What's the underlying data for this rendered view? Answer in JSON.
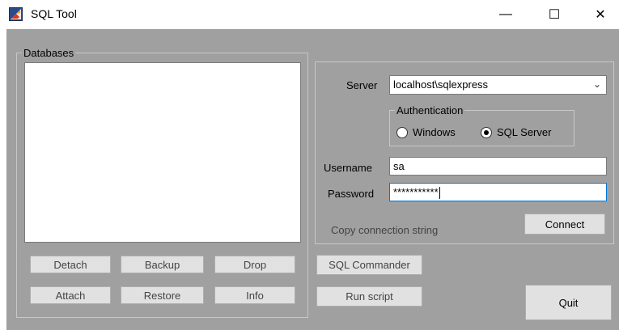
{
  "window": {
    "title": "SQL Tool",
    "controls": {
      "minimize": "—",
      "maximize": "☐",
      "close": "✕"
    }
  },
  "databases": {
    "group_label": "Databases",
    "items": [],
    "buttons": {
      "detach": "Detach",
      "backup": "Backup",
      "drop": "Drop",
      "attach": "Attach",
      "restore": "Restore",
      "info": "Info"
    }
  },
  "connection": {
    "server_label": "Server",
    "server_value": "localhost\\sqlexpress",
    "authentication_label": "Authentication",
    "auth_windows": "Windows",
    "auth_sqlserver": "SQL Server",
    "auth_selected": "SQL Server",
    "username_label": "Username",
    "username_value": "sa",
    "password_label": "Password",
    "password_value": "***********",
    "copy_link": "Copy connection string",
    "connect_button": "Connect"
  },
  "actions": {
    "sql_commander": "SQL Commander",
    "run_script": "Run script",
    "quit": "Quit"
  },
  "colors": {
    "client_bg": "#a0a0a0",
    "button_bg": "#e1e1e1",
    "focus_border": "#0078d7"
  }
}
